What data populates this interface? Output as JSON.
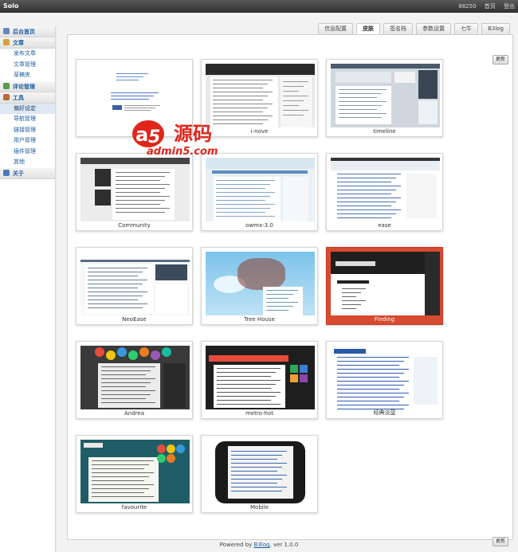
{
  "topbar": {
    "brand": "Solo",
    "user": "88250",
    "home": "首页",
    "logout": "登出"
  },
  "sidebar": {
    "items": [
      {
        "type": "section",
        "label": "后台首页",
        "icon": "dashboard-icon",
        "color": "#6a86b8"
      },
      {
        "type": "section",
        "label": "文章",
        "icon": "article-icon",
        "color": "#d9a23a"
      },
      {
        "type": "sub",
        "label": "发布文章"
      },
      {
        "type": "sub",
        "label": "文章管理"
      },
      {
        "type": "sub",
        "label": "草稿夹"
      },
      {
        "type": "section",
        "label": "评论管理",
        "icon": "comment-icon",
        "color": "#5a9a4a"
      },
      {
        "type": "section",
        "label": "工具",
        "icon": "tools-icon",
        "color": "#b86a3a"
      },
      {
        "type": "sub",
        "label": "偏好设定",
        "active": true
      },
      {
        "type": "sub",
        "label": "导航管理"
      },
      {
        "type": "sub",
        "label": "链接管理"
      },
      {
        "type": "sub",
        "label": "用户管理"
      },
      {
        "type": "sub",
        "label": "插件管理"
      },
      {
        "type": "sub",
        "label": "其他"
      },
      {
        "type": "section",
        "label": "关于",
        "icon": "about-icon",
        "color": "#4a7ab8"
      }
    ]
  },
  "tabs": [
    {
      "label": "信息配置",
      "active": false
    },
    {
      "label": "皮肤",
      "active": true
    },
    {
      "label": "签名档",
      "active": false
    },
    {
      "label": "参数设置",
      "active": false
    },
    {
      "label": "七牛",
      "active": false
    },
    {
      "label": "B3log",
      "active": false
    }
  ],
  "refresh_label": "更新",
  "skins": [
    {
      "name": "",
      "style": "white"
    },
    {
      "name": "i-nove",
      "style": "dark-header"
    },
    {
      "name": "timeline",
      "style": "gray"
    },
    {
      "name": "Community",
      "style": "dark-card"
    },
    {
      "name": "owmx-3.0",
      "style": "blue-light"
    },
    {
      "name": "ease",
      "style": "white-blue"
    },
    {
      "name": "NeoEase",
      "style": "white-gray"
    },
    {
      "name": "Tree House",
      "style": "sky"
    },
    {
      "name": "Finding",
      "style": "finding",
      "selected": true
    },
    {
      "name": "Andrea",
      "style": "dark-colorful"
    },
    {
      "name": "metro-hot",
      "style": "metro"
    },
    {
      "name": "经典淡蓝",
      "style": "classic-blue"
    },
    {
      "name": "favourite",
      "style": "teal"
    },
    {
      "name": "Mobile",
      "style": "phone"
    }
  ],
  "watermark": {
    "text_a": "a5",
    "text_cn": "源码",
    "text_sub": "admin5.com"
  },
  "footer": {
    "prefix": "Powered by ",
    "link": "B3log",
    "suffix": ", ver 1.0.0"
  }
}
